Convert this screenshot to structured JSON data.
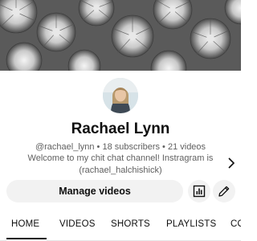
{
  "channel": {
    "name": "Rachael Lynn",
    "meta": "@rachael_lynn • 18 subscribers • 21 videos",
    "description_line1": "Welcome to my chit chat channel! Instragram is",
    "description_line2": "(rachael_halchishick)"
  },
  "actions": {
    "manage_label": "Manage videos",
    "analytics_icon": "analytics-icon",
    "edit_icon": "pencil-icon"
  },
  "tabs": [
    {
      "label": "HOME",
      "active": true
    },
    {
      "label": "VIDEOS",
      "active": false
    },
    {
      "label": "SHORTS",
      "active": false
    },
    {
      "label": "PLAYLISTS",
      "active": false
    },
    {
      "label": "CO",
      "active": false
    }
  ],
  "colors": {
    "text_primary": "#0f0f0f",
    "text_secondary": "#606060",
    "button_bg": "#f2f2f2"
  }
}
